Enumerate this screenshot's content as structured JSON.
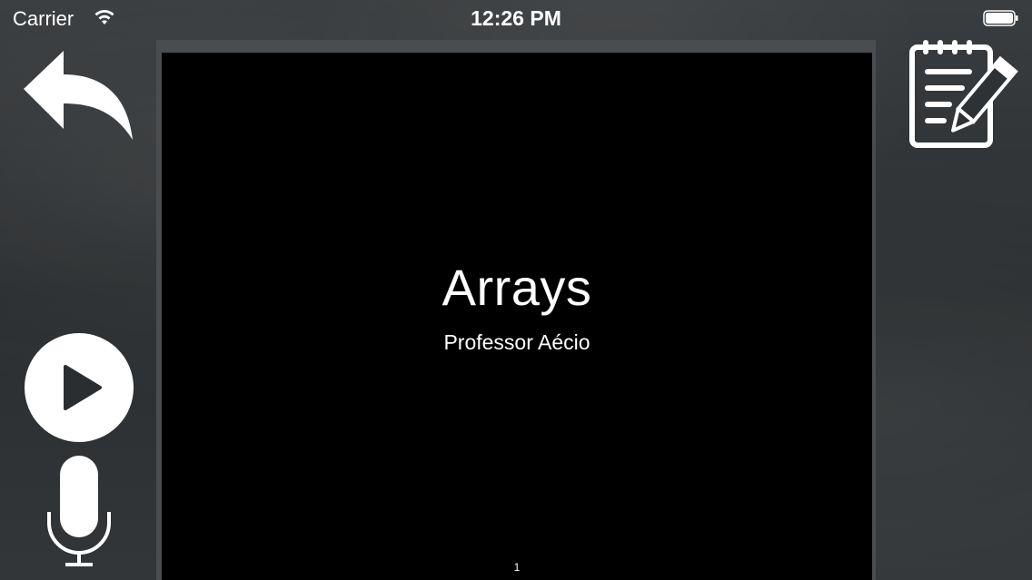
{
  "status_bar": {
    "carrier": "Carrier",
    "time": "12:26 PM"
  },
  "slide": {
    "title": "Arrays",
    "subtitle": "Professor Aécio",
    "page_number": "1"
  },
  "icons": {
    "back": "back-arrow-icon",
    "notes": "notepad-pencil-icon",
    "play": "play-icon",
    "mic": "microphone-icon",
    "wifi": "wifi-icon",
    "battery": "battery-icon"
  },
  "colors": {
    "slide_background": "#000000",
    "icon_color": "#ffffff",
    "chalkboard": "#333638"
  }
}
